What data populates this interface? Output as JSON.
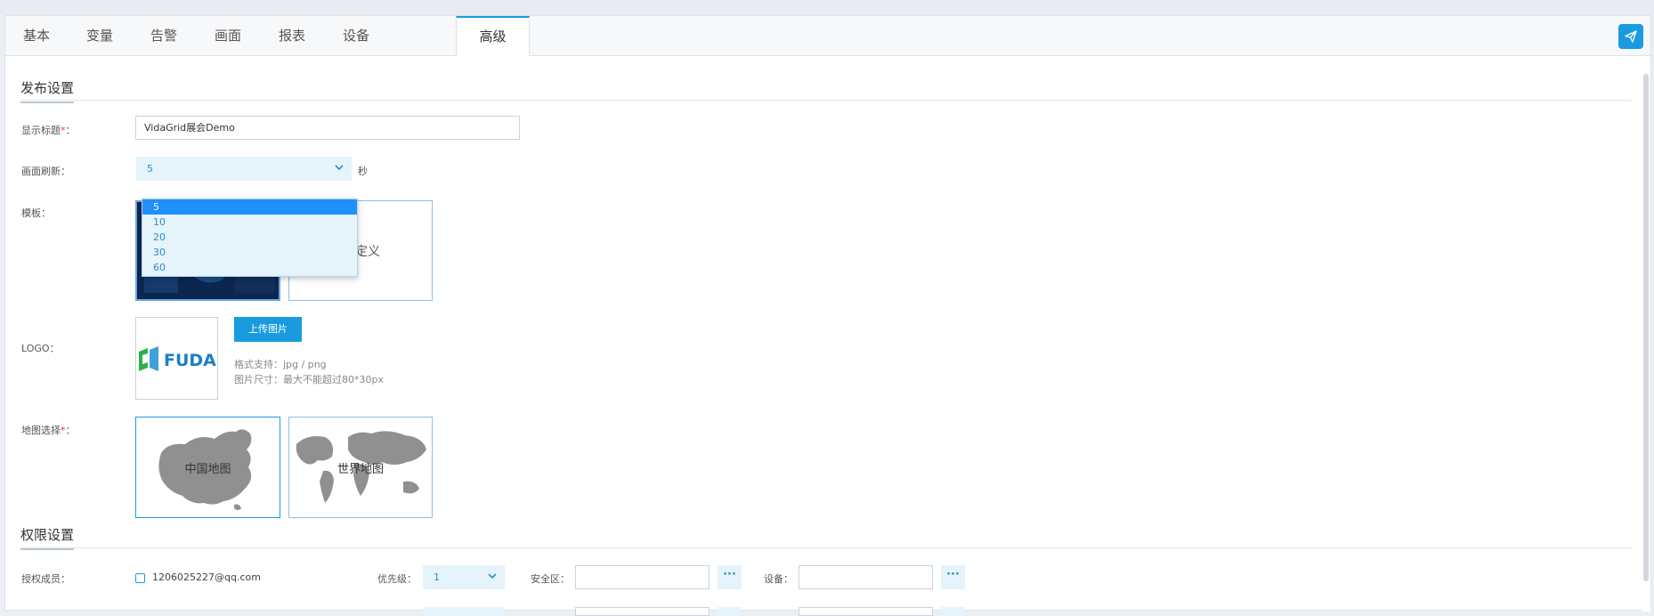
{
  "tabs": [
    {
      "label": "基本"
    },
    {
      "label": "变量"
    },
    {
      "label": "告警"
    },
    {
      "label": "画面"
    },
    {
      "label": "报表"
    },
    {
      "label": "设备"
    },
    {
      "label": "高级"
    }
  ],
  "active_tab": "高级",
  "publish": {
    "section_title": "发布设置",
    "title_label": "显示标题",
    "required_mark": "*",
    "colon": "：",
    "title_value": "VidaGrid展会Demo",
    "refresh_label": "画面刷新",
    "refresh_value": "5",
    "refresh_unit": "秒",
    "refresh_options": [
      "5",
      "10",
      "20",
      "30",
      "60"
    ],
    "template_label": "模板",
    "template_custom_partial": "定义",
    "logo_label": "LOGO",
    "logo_text": "FUDA",
    "upload_label": "上传图片",
    "format_hint": "格式支持：jpg / png",
    "size_hint": "图片尺寸：最大不能超过80*30px",
    "map_label": "地图选择",
    "map_china": "中国地图",
    "map_world": "世界地图"
  },
  "permission": {
    "section_title": "权限设置",
    "member_label": "授权成员：",
    "member_email": "1206025227@qq.com",
    "priority_label": "优先级：",
    "priority_value": "1",
    "zone_label": "安全区：",
    "zone_value": "",
    "device_label": "设备：",
    "device_value": "",
    "more": "···"
  },
  "colors": {
    "accent": "#1a9be0",
    "select_bg": "#e5f3fb",
    "selected_option": "#1e90ff",
    "required": "#e33333",
    "template_dark": "#0d2a55"
  }
}
